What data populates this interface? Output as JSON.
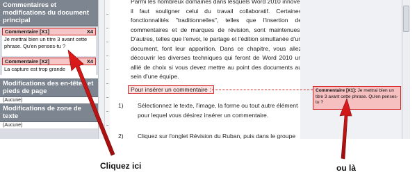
{
  "reviewing_pane": {
    "section_main": "Commentaires et modifications du document principal",
    "comments": [
      {
        "header": "Commentaire [X1]",
        "author": "X4",
        "text": "Je mettrai bien un titre 3 avant cette phrase. Qu'en penses-tu ?"
      },
      {
        "header": "Commentaire [X2]",
        "author": "X4",
        "text": "La capture est trop grande"
      }
    ],
    "section_header_footer": "Modifications des en-têtes et pieds de page",
    "header_footer_value": "(Aucune)",
    "section_textbox": "Modifications de zone de texte",
    "textbox_value": "(Aucune)"
  },
  "document": {
    "paragraph": "Parmi les nombreux domaines dans lesquels Word 2010 innove, il faut souligner celui du travail collaboratif. Certaines fonctionnalités \"traditionnelles\", telles que l'insertion de commentaires et de marques de révision, sont maintenues. D'autres, telles que l'envoi, le partage et l'édition simultanée d'un document, font leur apparition. Dans ce chapitre, vous allez découvrir les diverses techniques qui feront de Word 2010 un allié de choix si vous devez mettre au point des documents au sein d'une équipe.",
    "heading": "Pour insérer un commentaire :",
    "list": [
      {
        "num": "1)",
        "text": "Sélectionnez le texte, l'image, la forme ou tout autre élément pour lequel vous désirez insérer un commentaire."
      },
      {
        "num": "2)",
        "text": "Cliquez sur l'onglet Révision du Ruban, puis dans le groupe Commentaires, cliquez sur Nouveau."
      }
    ]
  },
  "balloon": {
    "header": "Commentaire [X1]:",
    "text": "Je mettrai bien un titre 3 avant cette phrase. Qu'en penses-tu ?"
  },
  "callouts": {
    "left": "Cliquez ici",
    "right": "ou là"
  },
  "colors": {
    "comment_red": "#d22222",
    "pane_header": "#7d8591",
    "balloon_fill": "#f6bfc0"
  }
}
